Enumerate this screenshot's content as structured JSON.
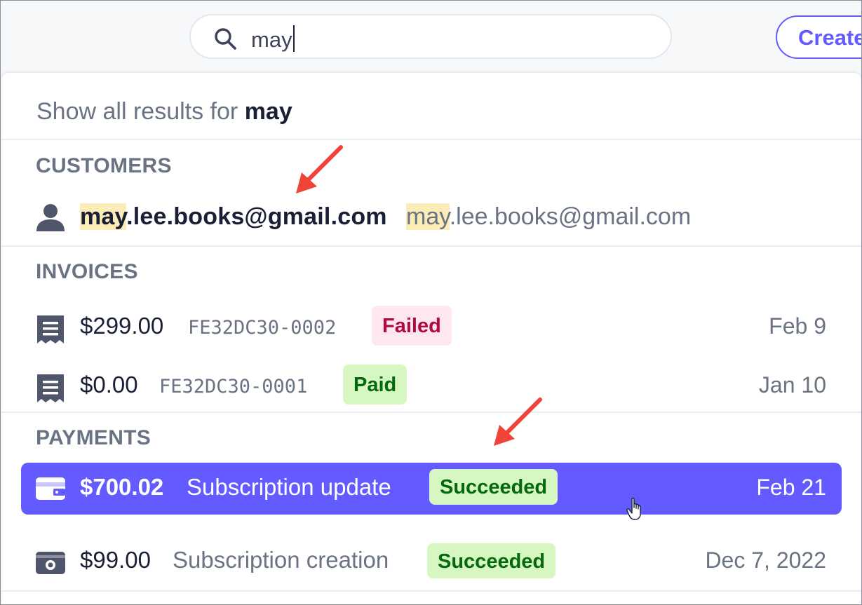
{
  "search": {
    "value": "may",
    "create_label": "Create"
  },
  "dropdown": {
    "show_all_prefix": "Show all results for",
    "show_all_query": "may",
    "customers": {
      "title": "CUSTOMERS",
      "item": {
        "name_highlight": "may",
        "name_rest": ".lee.books@gmail.com",
        "email_highlight": "may",
        "email_rest": ".lee.books@gmail.com"
      }
    },
    "invoices": {
      "title": "INVOICES",
      "items": [
        {
          "amount": "$299.00",
          "number": "FE32DC30-0002",
          "status": "Failed",
          "date": "Feb 9"
        },
        {
          "amount": "$0.00",
          "number": "FE32DC30-0001",
          "status": "Paid",
          "date": "Jan 10"
        }
      ]
    },
    "payments": {
      "title": "PAYMENTS",
      "items": [
        {
          "amount": "$700.02",
          "description": "Subscription update",
          "status": "Succeeded",
          "date": "Feb 21"
        },
        {
          "amount": "$99.00",
          "description": "Subscription creation",
          "status": "Succeeded",
          "date": "Dec 7, 2022"
        }
      ]
    }
  },
  "colors": {
    "accent": "#635bff",
    "arrow": "#f04438",
    "highlight": "#fbecb8"
  },
  "icons": [
    "search-icon",
    "person-icon",
    "receipt-icon",
    "wallet-icon",
    "hand-cursor-icon",
    "red-arrow"
  ]
}
